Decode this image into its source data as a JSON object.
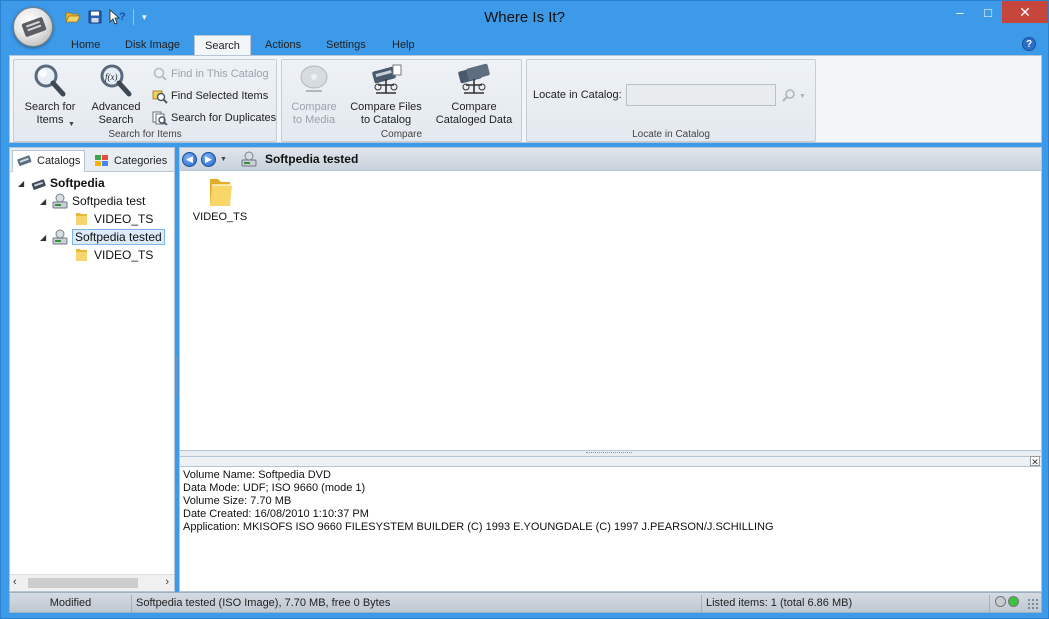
{
  "window": {
    "title": "Where Is It?"
  },
  "titlebar": {
    "minimize": "–",
    "maximize": "□",
    "close": "✕"
  },
  "tabs": [
    {
      "label": "Home"
    },
    {
      "label": "Disk Image"
    },
    {
      "label": "Search"
    },
    {
      "label": "Actions"
    },
    {
      "label": "Settings"
    },
    {
      "label": "Help"
    }
  ],
  "help_glyph": "?",
  "ribbon": {
    "search_group": {
      "label": "Search for Items",
      "search_for_items": "Search for\nItems",
      "advanced_search": "Advanced\nSearch",
      "find_in_catalog": "Find in This Catalog",
      "find_selected": "Find Selected Items",
      "search_duplicates": "Search for Duplicates"
    },
    "compare_group": {
      "label": "Compare",
      "compare_to_media": "Compare\nto Media",
      "compare_files": "Compare Files\nto Catalog",
      "compare_cataloged": "Compare\nCataloged Data"
    },
    "locate_group": {
      "label": "Locate in Catalog",
      "field_label": "Locate in Catalog:",
      "field_value": ""
    }
  },
  "left_panel": {
    "tabs": [
      {
        "label": "Catalogs"
      },
      {
        "label": "Categories"
      }
    ],
    "tree": [
      {
        "label": "Softpedia",
        "toggle": "◢"
      },
      {
        "label": "Softpedia test",
        "toggle": "◢"
      },
      {
        "label": "VIDEO_TS"
      },
      {
        "label": "Softpedia tested",
        "toggle": "◢"
      },
      {
        "label": "VIDEO_TS"
      }
    ]
  },
  "path_bar": {
    "title": "Softpedia tested"
  },
  "file_view": {
    "items": [
      {
        "label": "VIDEO_TS"
      }
    ]
  },
  "info_panel": {
    "close": "✕",
    "lines": [
      "Volume Name: Softpedia DVD",
      "Data Mode: UDF; ISO 9660 (mode 1)",
      "Volume Size: 7.70 MB",
      "Date Created: 16/08/2010 1:10:37 PM",
      "Application: MKISOFS ISO 9660 FILESYSTEM BUILDER (C) 1993 E.YOUNGDALE (C) 1997 J.PEARSON/J.SCHILLING"
    ]
  },
  "status": {
    "modified": "Modified",
    "catalog_info": "Softpedia tested (ISO Image), 7.70 MB, free 0 Bytes",
    "listed": "Listed items: 1 (total 6.86 MB)"
  },
  "colors": {
    "accent": "#3c9ae8",
    "close": "#c7463b",
    "folder": "#f3c44a"
  },
  "icons": {
    "app": "app-orb-icon",
    "open": "folder-open-icon",
    "save": "save-icon",
    "help": "help-cursor-icon",
    "search": "magnifier-icon",
    "advanced": "function-magnifier-icon",
    "catalog": "catalog-drive-icon",
    "folder": "folder-icon"
  }
}
